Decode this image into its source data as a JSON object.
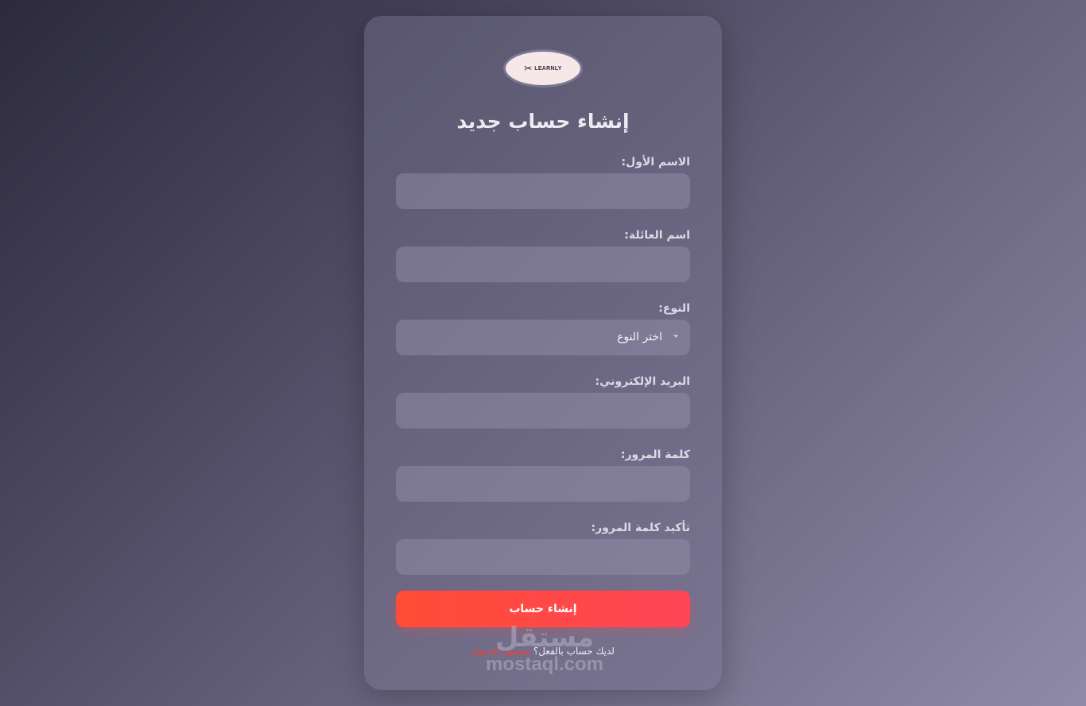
{
  "logo": {
    "mark": "✂",
    "text": "LEARNLY"
  },
  "title": "إنشاء حساب جديد",
  "fields": {
    "first_name": {
      "label": "الاسم الأول:",
      "value": "",
      "placeholder": ""
    },
    "last_name": {
      "label": "اسم العائلة:",
      "value": "",
      "placeholder": ""
    },
    "gender": {
      "label": "النوع:",
      "selected": "اختر النوع"
    },
    "email": {
      "label": "البريد الإلكتروني:",
      "value": "",
      "placeholder": ""
    },
    "password": {
      "label": "كلمة المرور:",
      "value": "",
      "placeholder": ""
    },
    "confirm_password": {
      "label": "تأكيد كلمة المرور:",
      "value": "",
      "placeholder": ""
    }
  },
  "submit_label": "إنشاء حساب",
  "footer": {
    "text": "لديك حساب بالفعل؟",
    "link": "تسجيل الدخول"
  },
  "watermark": {
    "arabic": "مستقل",
    "latin": "mostaql.com"
  },
  "colors": {
    "accent": "#ff4558",
    "link": "#ff3b30"
  }
}
